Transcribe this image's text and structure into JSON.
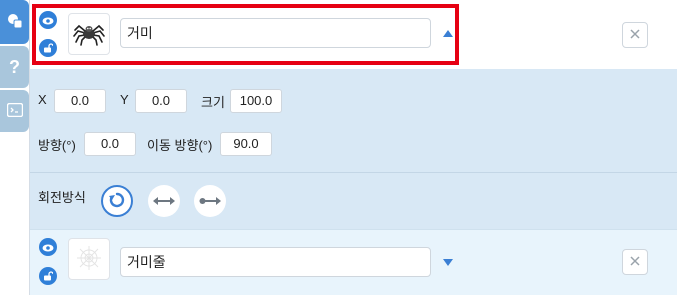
{
  "side_tabs": [
    {
      "icon": "shapes-icon",
      "active": true
    },
    {
      "icon": "question-icon",
      "label": "?"
    },
    {
      "icon": "console-icon"
    }
  ],
  "sprites": [
    {
      "name": "거미",
      "visible": true,
      "locked": false,
      "expanded": true,
      "thumbnail": "spider-icon"
    },
    {
      "name": "거미줄",
      "visible": true,
      "locked": false,
      "expanded": false,
      "thumbnail": "web-icon"
    }
  ],
  "properties": {
    "x_label": "X",
    "x_value": "0.0",
    "y_label": "Y",
    "y_value": "0.0",
    "size_label": "크기",
    "size_value": "100.0",
    "direction_label": "방향(°)",
    "direction_value": "0.0",
    "move_direction_label": "이동 방향(°)",
    "move_direction_value": "90.0",
    "rotation_label": "회전방식",
    "rotation_modes": [
      "rotate-all-around-icon",
      "left-right-icon",
      "no-rotate-icon"
    ],
    "rotation_selected": 0
  },
  "colors": {
    "accent": "#3a7fd4",
    "highlight": "#e60012",
    "props_bg": "#d8e8f5"
  }
}
